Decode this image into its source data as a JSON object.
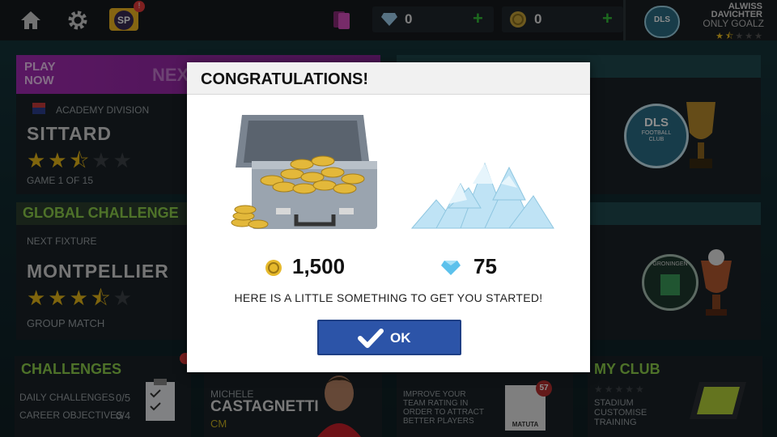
{
  "topbar": {
    "sp_label": "SP",
    "sp_notification": "!",
    "gems_value": "0",
    "coins_value": "0",
    "plus": "+",
    "profile": {
      "name_line1": "ALWISS",
      "name_line2": "DAVICHTER",
      "club": "ONLY GOALZ",
      "badge_text": "DLS",
      "stars": 1.5
    }
  },
  "background": {
    "play_now": "PLAY NOW",
    "next": "NEX",
    "academy_division": "ACADEMY DIVISION",
    "fixture1_team": "SITTARD",
    "fixture1_game": "GAME 1 OF 15",
    "global_challenge": "GLOBAL CHALLENGE",
    "next_fixture": "NEXT FIXTURE",
    "fixture2_team": "MONTPELLIER",
    "fixture2_label": "GROUP MATCH",
    "challenges": "CHALLENGES",
    "daily_challenges": "DAILY CHALLENGES",
    "daily_count": "0/5",
    "career_objectives": "CAREER OBJECTIVES",
    "career_count": "0/4",
    "player_first": "MICHELE",
    "player_last": "CASTAGNETTI",
    "player_pos": "CM",
    "improve_text_1": "IMPROVE YOUR",
    "improve_text_2": "TEAM RATING IN",
    "improve_text_3": "ORDER TO ATTRACT",
    "improve_text_4": "BETTER PLAYERS",
    "card_rating": "57",
    "card_name": "MATUTA",
    "my_club": "MY CLUB",
    "club_stadium": "STADIUM",
    "club_customise": "CUSTOMISE",
    "club_training": "TRAINING",
    "dls_badge_1": "DLS",
    "dls_badge_2": "FOOTBALL",
    "dls_badge_3": "CLUB",
    "groningen_badge": "GRONINGEN"
  },
  "modal": {
    "title": "CONGRATULATIONS!",
    "coins_amount": "1,500",
    "gems_amount": "75",
    "message": "HERE IS A LITTLE SOMETHING TO GET YOU STARTED!",
    "ok_label": "OK"
  },
  "colors": {
    "accent_green": "#8ed04b",
    "button_blue": "#2c54a8",
    "star_gold": "#e8b819",
    "play_purple": "#a32bb3"
  }
}
